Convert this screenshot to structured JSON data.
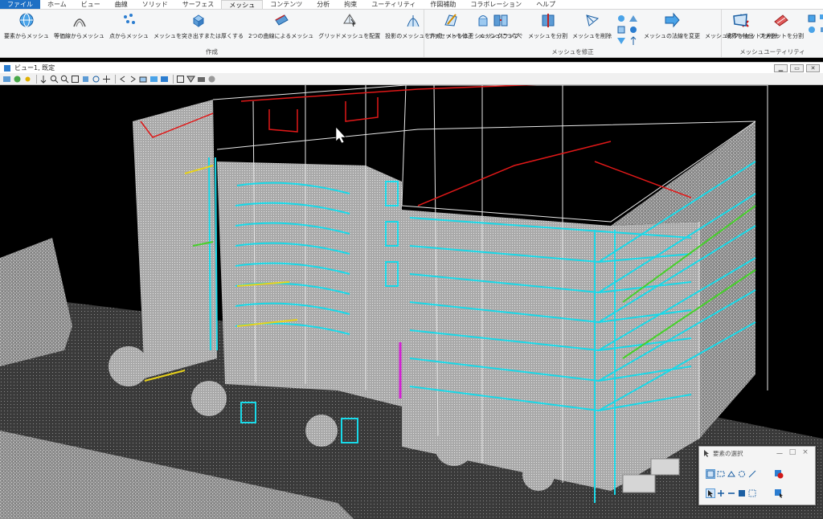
{
  "tabs": [
    {
      "label": "ファイル"
    },
    {
      "label": "ホーム"
    },
    {
      "label": "ビュー"
    },
    {
      "label": "曲線"
    },
    {
      "label": "ソリッド"
    },
    {
      "label": "サーフェス"
    },
    {
      "label": "メッシュ"
    },
    {
      "label": "コンテンツ"
    },
    {
      "label": "分析"
    },
    {
      "label": "拘束"
    },
    {
      "label": "ユーティリティ"
    },
    {
      "label": "作図補助"
    },
    {
      "label": "コラボレーション"
    },
    {
      "label": "ヘルプ"
    }
  ],
  "ribbon": {
    "create_group": {
      "label": "作成",
      "buttons": [
        {
          "label": "要素からメッシュ",
          "icon": "globe-mesh-icon"
        },
        {
          "label": "等価線からメッシュ",
          "icon": "contour-mesh-icon"
        },
        {
          "label": "点からメッシュ",
          "icon": "points-mesh-icon"
        },
        {
          "label": "メッシュを突き出すまたは厚くする",
          "icon": "extrude-mesh-icon"
        },
        {
          "label": "2つの曲線によるメッシュ",
          "icon": "two-curve-mesh-icon"
        },
        {
          "label": "グリッドメッシュを配置",
          "icon": "grid-mesh-icon"
        },
        {
          "label": "投影のメッシュを作成",
          "icon": "projection-mesh-icon"
        },
        {
          "label": "メッシュをシュリンクラップ",
          "icon": "shrinkwrap-icon"
        }
      ]
    },
    "modify_group": {
      "label": "メッシュを修正",
      "buttons": [
        {
          "label": "ファセットを修正",
          "icon": "edit-facet-icon"
        },
        {
          "label": "メッシュにつなぐ",
          "icon": "join-mesh-icon"
        },
        {
          "label": "メッシュを分割",
          "icon": "split-mesh-icon"
        },
        {
          "label": "メッシュを削除",
          "icon": "delete-mesh-icon"
        },
        {
          "label": "メッシュの法線を変更",
          "icon": "normal-arrow-icon"
        },
        {
          "label": "メッシュのファセットを削除",
          "icon": "delete-facet-icon"
        }
      ]
    },
    "utility_group": {
      "label": "メッシュユーティリティ",
      "buttons": [
        {
          "label": "境界を抽出",
          "icon": "boundary-icon"
        },
        {
          "label": "ファセットを分割",
          "icon": "split-facet-icon"
        }
      ]
    }
  },
  "view_window": {
    "title": "ビュー1, 既定",
    "controls": [
      "minimize",
      "restore",
      "close"
    ]
  },
  "select_panel": {
    "title": "要素の選択",
    "controls": [
      "ー",
      "□",
      "×"
    ]
  },
  "colors": {
    "file_tab": "#1e6fc4",
    "cyan_outline": "#19d9e8",
    "red_outline": "#e01818",
    "yellow_outline": "#e8d21a",
    "green_outline": "#46d12a",
    "magenta_outline": "#d020d0",
    "pointcloud": "#b8b8b8"
  }
}
